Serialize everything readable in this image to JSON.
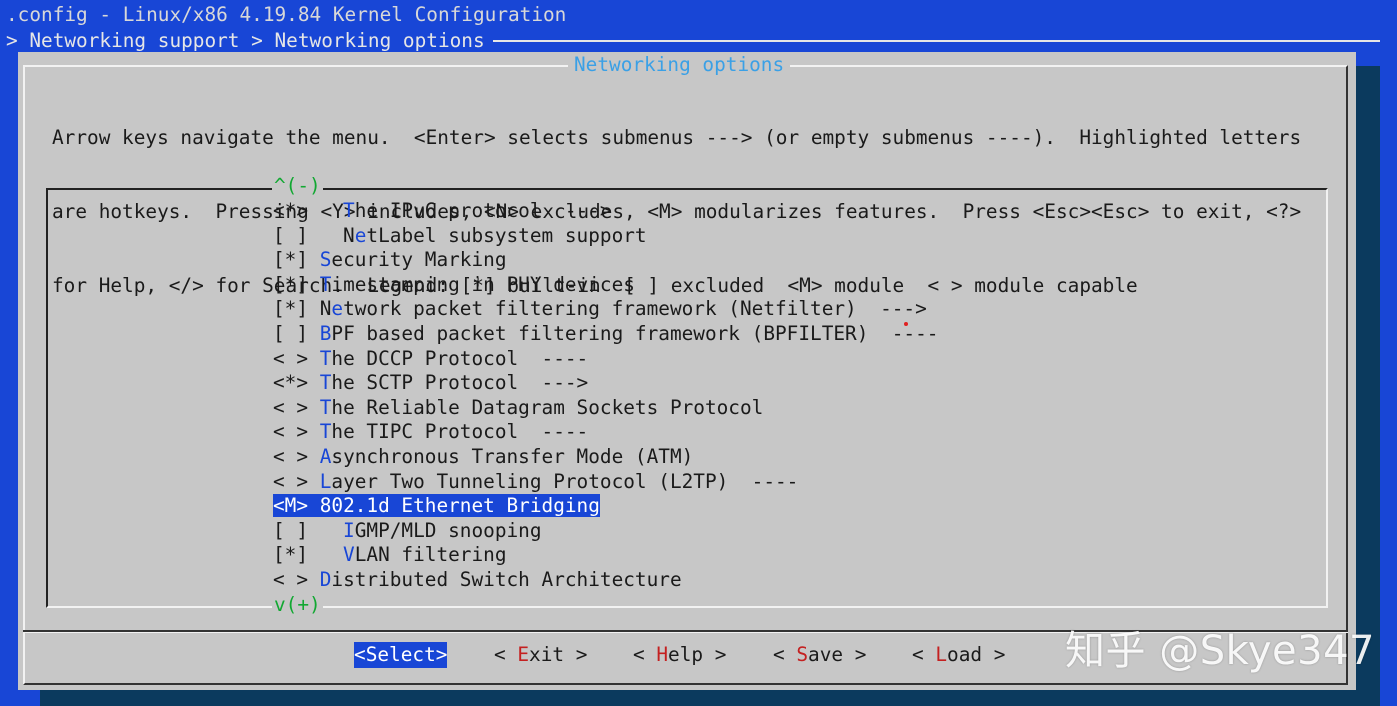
{
  "window": {
    "title": ".config - Linux/x86 4.19.84 Kernel Configuration",
    "breadcrumb": "> Networking support > Networking options"
  },
  "dialog": {
    "title": "Networking options",
    "help_lines": [
      "Arrow keys navigate the menu.  <Enter> selects submenus ---> (or empty submenus ----).  Highlighted letters",
      "are hotkeys.  Pressing <Y> includes, <N> excludes, <M> modularizes features.  Press <Esc><Esc> to exit, <?>",
      "for Help, </> for Search.  Legend: [*] built-in  [ ] excluded  <M> module  < > module capable"
    ],
    "scroll_up": "^(-)",
    "scroll_down": "v(+)"
  },
  "menu": {
    "items": [
      {
        "prefix": "<*>   ",
        "hotkey": "T",
        "rest": "he IPv6 protocol  --->",
        "selected": false
      },
      {
        "prefix": "[ ]   N",
        "hotkey": "e",
        "rest": "tLabel subsystem support",
        "selected": false
      },
      {
        "prefix": "[*] ",
        "hotkey": "S",
        "rest": "ecurity Marking",
        "selected": false
      },
      {
        "prefix": "[*] ",
        "hotkey": "T",
        "rest": "imestamping in PHY devices",
        "selected": false
      },
      {
        "prefix": "[*] N",
        "hotkey": "e",
        "rest": "twork packet filtering framework (Netfilter)  --->",
        "selected": false
      },
      {
        "prefix": "[ ] ",
        "hotkey": "B",
        "rest": "PF based packet filtering framework (BPFILTER)  ----",
        "selected": false
      },
      {
        "prefix": "< > ",
        "hotkey": "T",
        "rest": "he DCCP Protocol  ----",
        "selected": false
      },
      {
        "prefix": "<*> ",
        "hotkey": "T",
        "rest": "he SCTP Protocol  --->",
        "selected": false
      },
      {
        "prefix": "< > ",
        "hotkey": "T",
        "rest": "he Reliable Datagram Sockets Protocol",
        "selected": false
      },
      {
        "prefix": "< > ",
        "hotkey": "T",
        "rest": "he TIPC Protocol  ----",
        "selected": false
      },
      {
        "prefix": "< > ",
        "hotkey": "A",
        "rest": "synchronous Transfer Mode (ATM)",
        "selected": false
      },
      {
        "prefix": "< > ",
        "hotkey": "L",
        "rest": "ayer Two Tunneling Protocol (L2TP)  ----",
        "selected": false
      },
      {
        "prefix": "<M> ",
        "hotkey": "8",
        "rest": "02.1d Ethernet Bridging",
        "selected": true
      },
      {
        "prefix": "[ ]   ",
        "hotkey": "I",
        "rest": "GMP/MLD snooping",
        "selected": false
      },
      {
        "prefix": "[*]   ",
        "hotkey": "V",
        "rest": "LAN filtering",
        "selected": false
      },
      {
        "prefix": "< > ",
        "hotkey": "D",
        "rest": "istributed Switch Architecture",
        "selected": false
      }
    ]
  },
  "buttons": {
    "select": {
      "pre": "<",
      "hot": "S",
      "post": "elect>"
    },
    "exit": {
      "pre": "< ",
      "hot": "E",
      "post": "xit >"
    },
    "help": {
      "pre": "< ",
      "hot": "H",
      "post": "elp >"
    },
    "save": {
      "pre": "< ",
      "hot": "S",
      "post": "ave >"
    },
    "load": {
      "pre": "< ",
      "hot": "L",
      "post": "oad >"
    }
  },
  "watermark": "知乎 @Skye347",
  "colors": {
    "terminal_blue": "#1846d6",
    "dialog_gray": "#c7c7c7",
    "hotkey_blue": "#1846d6",
    "title_cyan": "#3aa0e6",
    "scroll_green": "#12a832",
    "button_hotkey_red": "#c42020"
  }
}
